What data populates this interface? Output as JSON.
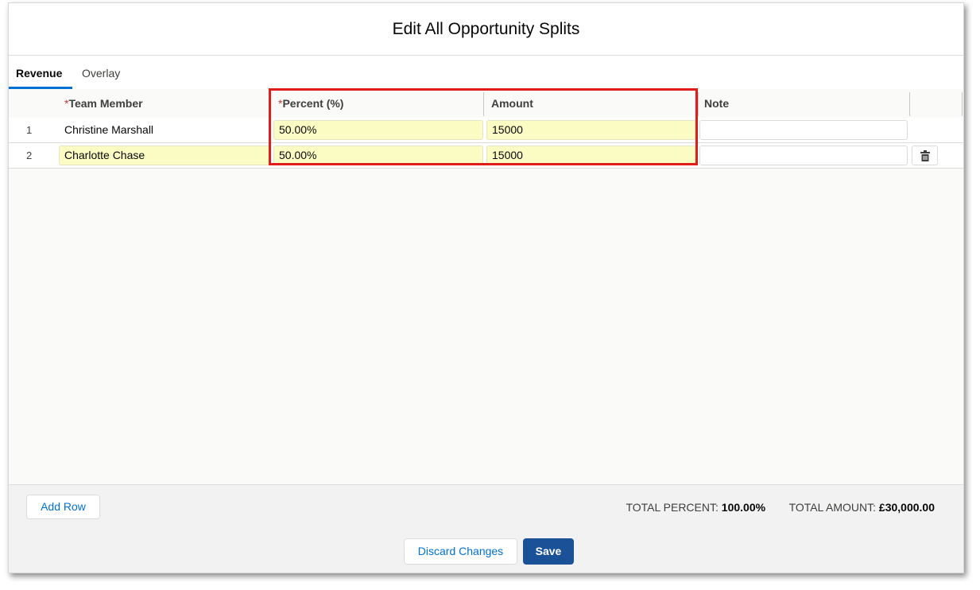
{
  "modal": {
    "title": "Edit All Opportunity Splits"
  },
  "tabs": [
    {
      "label": "Revenue",
      "active": true
    },
    {
      "label": "Overlay",
      "active": false
    }
  ],
  "grid": {
    "columns": {
      "team_member": {
        "required_mark": "*",
        "label": "Team Member"
      },
      "percent": {
        "required_mark": "*",
        "label": "Percent (%)"
      },
      "amount": {
        "label": "Amount"
      },
      "note": {
        "label": "Note"
      }
    },
    "rows": [
      {
        "num": "1",
        "team_member": "Christine Marshall",
        "percent": "50.00%",
        "amount": "15000",
        "note": ""
      },
      {
        "num": "2",
        "team_member": "Charlotte Chase",
        "percent": "50.00%",
        "amount": "15000",
        "note": ""
      }
    ]
  },
  "footer": {
    "add_row_label": "Add Row",
    "total_percent_label": "TOTAL PERCENT:",
    "total_percent_value": "100.00%",
    "total_amount_label": "TOTAL AMOUNT:",
    "total_amount_value": "£30,000.00"
  },
  "actions": {
    "discard_label": "Discard Changes",
    "save_label": "Save"
  },
  "colors": {
    "accent": "#0070d2",
    "save_button": "#1b5297",
    "edited_cell": "#fbfcc4",
    "annotation_box": "#e21b1b",
    "required": "#c23934"
  },
  "icons": {
    "delete_row": "trash-icon"
  }
}
